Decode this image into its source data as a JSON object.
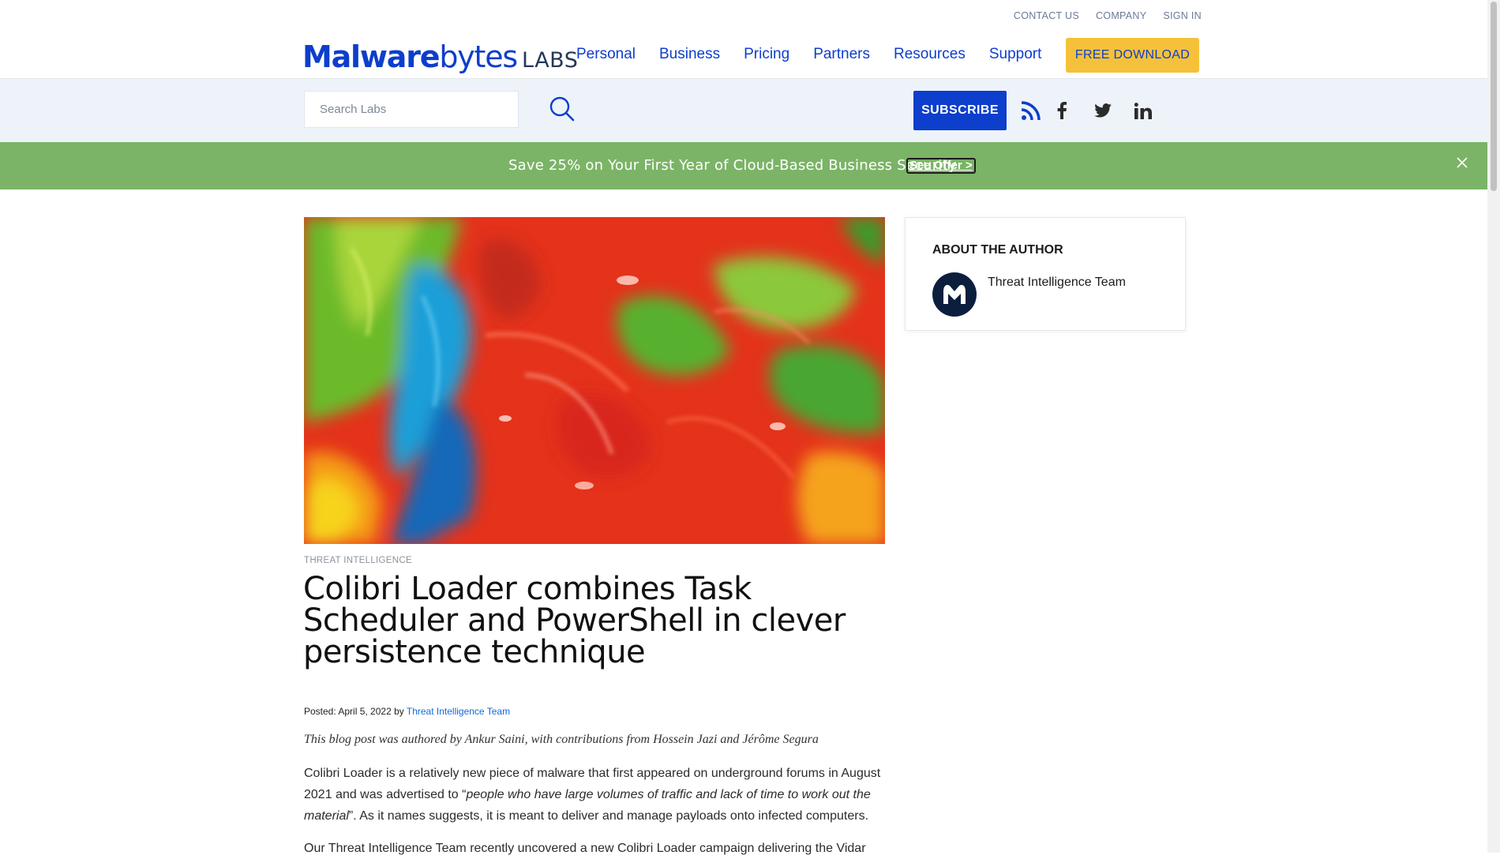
{
  "header": {
    "util_nav": [
      "CONTACT US",
      "COMPANY",
      "SIGN IN"
    ],
    "logo": {
      "brand_bold": "Malware",
      "brand_rest": "bytes",
      "labs": "LABS"
    },
    "main_nav": [
      "Personal",
      "Business",
      "Pricing",
      "Partners",
      "Resources",
      "Support"
    ],
    "download_label": "FREE DOWNLOAD",
    "brand_color": "#0d3ecc",
    "download_color": "#f5c13a"
  },
  "subbar": {
    "search_placeholder": "Search Labs",
    "subscribe_label": "SUBSCRIBE",
    "social_icons": [
      "rss-icon",
      "facebook-icon",
      "twitter-icon",
      "linkedin-icon"
    ]
  },
  "promo": {
    "text": "Save 25% on Your First Year of Cloud-Based Business Security",
    "link": "See Offer >",
    "background": "#7bb466"
  },
  "article": {
    "category": "THREAT INTELLIGENCE",
    "title": "Colibri Loader combines Task Scheduler and PowerShell in clever persistence technique",
    "meta": {
      "posted": "Posted: April 5, 2022 by ",
      "author": "Threat Intelligence Team"
    },
    "intro": "This blog post was authored by Ankur Saini, with contributions from Hossein Jazi and Jérôme Segura",
    "p1": {
      "before": "Colibri Loader is a relatively new piece of malware that first appeared on underground forums in August 2021 and was advertised to “",
      "quote": "people who have large volumes of traffic and lack of time to work out the material",
      "after": "”. As it names suggests, it is meant to deliver and manage payloads onto infected computers."
    },
    "p2": "Our Threat Intelligence Team recently uncovered a new Colibri Loader campaign delivering the Vidar"
  },
  "sidebar": {
    "heading": "ABOUT THE AUTHOR",
    "author_name": "Threat Intelligence Team"
  }
}
